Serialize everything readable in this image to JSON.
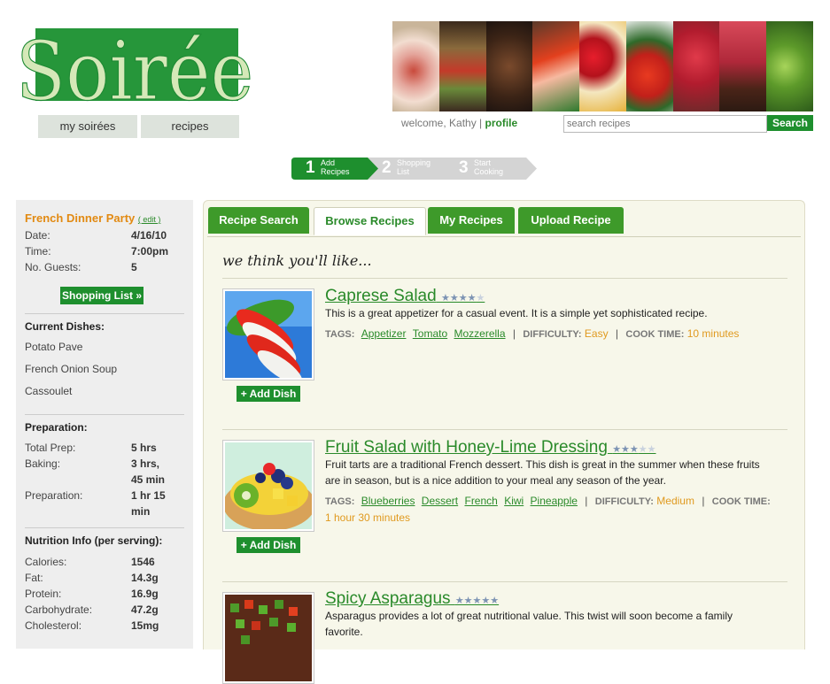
{
  "logo": {
    "text": "Soirée"
  },
  "nav": {
    "my_soirees": "my soirées",
    "recipes": "recipes"
  },
  "header": {
    "welcome": "welcome, Kathy",
    "separator": "|",
    "profile": "profile",
    "search_placeholder": "search recipes",
    "search_button": "Search"
  },
  "steps": [
    {
      "num": "1",
      "line1": "Add",
      "line2": "Recipes",
      "active": true
    },
    {
      "num": "2",
      "line1": "Shopping",
      "line2": "List",
      "active": false
    },
    {
      "num": "3",
      "line1": "Start",
      "line2": "Cooking",
      "active": false
    }
  ],
  "sidebar": {
    "party": {
      "title": "French Dinner Party",
      "edit": "( edit )"
    },
    "details": [
      {
        "label": "Date:",
        "value": "4/16/10"
      },
      {
        "label": "Time:",
        "value": "7:00pm"
      },
      {
        "label": "No. Guests:",
        "value": "5"
      }
    ],
    "shopping_button": "Shopping List »",
    "dishes_heading": "Current Dishes:",
    "dishes": [
      "Potato Pave",
      "French Onion Soup",
      "Cassoulet"
    ],
    "prep_heading": "Preparation:",
    "prep": [
      {
        "label": "Total Prep:",
        "value": "5 hrs"
      },
      {
        "label": "Baking:",
        "value": "3 hrs,",
        "value2": "45 min"
      },
      {
        "label": "Preparation:",
        "value": "1 hr 15",
        "value2": "min"
      }
    ],
    "nutrition_heading": "Nutrition Info (per serving):",
    "nutrition": [
      {
        "label": "Calories:",
        "value": "1546"
      },
      {
        "label": "Fat:",
        "value": "14.3g"
      },
      {
        "label": "Protein:",
        "value": "16.9g"
      },
      {
        "label": "Carbohydrate:",
        "value": "47.2g"
      },
      {
        "label": "Cholesterol:",
        "value": "15mg"
      }
    ]
  },
  "tabs": [
    {
      "label": "Recipe Search",
      "active": false
    },
    {
      "label": "Browse Recipes",
      "active": true
    },
    {
      "label": "My Recipes",
      "active": false
    },
    {
      "label": "Upload Recipe",
      "active": false
    }
  ],
  "main": {
    "heading": "we think you'll like..."
  },
  "recipes": [
    {
      "title": "Caprese Salad",
      "rating": 4,
      "max_rating": 5,
      "description": "This is a great appetizer for a casual event. It is a simple yet sophisticated recipe.",
      "tags_label": "TAGS:",
      "tags": [
        "Appetizer",
        "Tomato",
        "Mozzerella"
      ],
      "difficulty_label": "DIFFICULTY:",
      "difficulty": "Easy",
      "cook_time_label": "COOK TIME:",
      "cook_time": "10 minutes",
      "add_button": "+ Add Dish"
    },
    {
      "title": "Fruit Salad with Honey-Lime Dressing",
      "rating": 3,
      "max_rating": 5,
      "description": "Fruit tarts are a traditional French dessert. This dish is great in the summer when these fruits are in season, but is a nice addition to your meal any season of the year.",
      "tags_label": "TAGS:",
      "tags": [
        "Blueberries",
        "Dessert",
        "French",
        "Kiwi",
        "Pineapple"
      ],
      "difficulty_label": "DIFFICULTY:",
      "difficulty": "Medium",
      "cook_time_label": "COOK TIME:",
      "cook_time": "1 hour 30 minutes",
      "add_button": "+ Add Dish"
    },
    {
      "title": "Spicy Asparagus",
      "rating": 5,
      "max_rating": 5,
      "description": "Asparagus provides a lot of great nutritional value. This twist will soon become a family favorite."
    }
  ],
  "colors": {
    "brand_green": "#1e8f2e",
    "tab_green": "#3e9a2a",
    "accent_orange": "#e28a12",
    "sidebar_bg": "#eeeeee",
    "panel_bg": "#f7f7ea"
  }
}
